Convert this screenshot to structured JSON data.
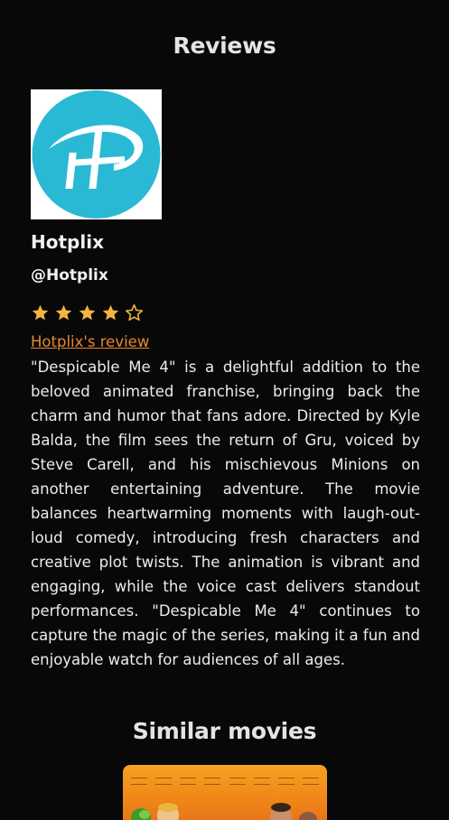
{
  "reviews_section": {
    "title": "Reviews"
  },
  "review": {
    "reviewer_name": "Hotplix",
    "reviewer_handle": "@Hotplix",
    "rating": {
      "value": 4,
      "max": 5
    },
    "link_label": "Hotplix's review",
    "body": "\"Despicable Me 4\" is a delightful addition to the beloved animated franchise, bringing back the charm and humor that fans adore. Directed by Kyle Balda, the film sees the return of Gru, voiced by Steve Carell, and his mischievous Minions on another entertaining adventure. The movie balances heartwarming moments with laugh-out-loud comedy, introducing fresh characters and creative plot twists. The animation is vibrant and engaging, while the voice cast delivers standout performances. \"Despicable Me 4\" continues to capture the magic of the series, making it a fun and enjoyable watch for audiences of all ages."
  },
  "similar_section": {
    "title": "Similar movies"
  },
  "colors": {
    "background": "#080808",
    "accent_link": "#e8872c",
    "star": "#f4b43d",
    "logo_teal": "#29b9d4"
  },
  "icons": {
    "avatar": "hotplix-logo",
    "star_filled": "star-filled-icon",
    "star_empty": "star-outline-icon"
  }
}
